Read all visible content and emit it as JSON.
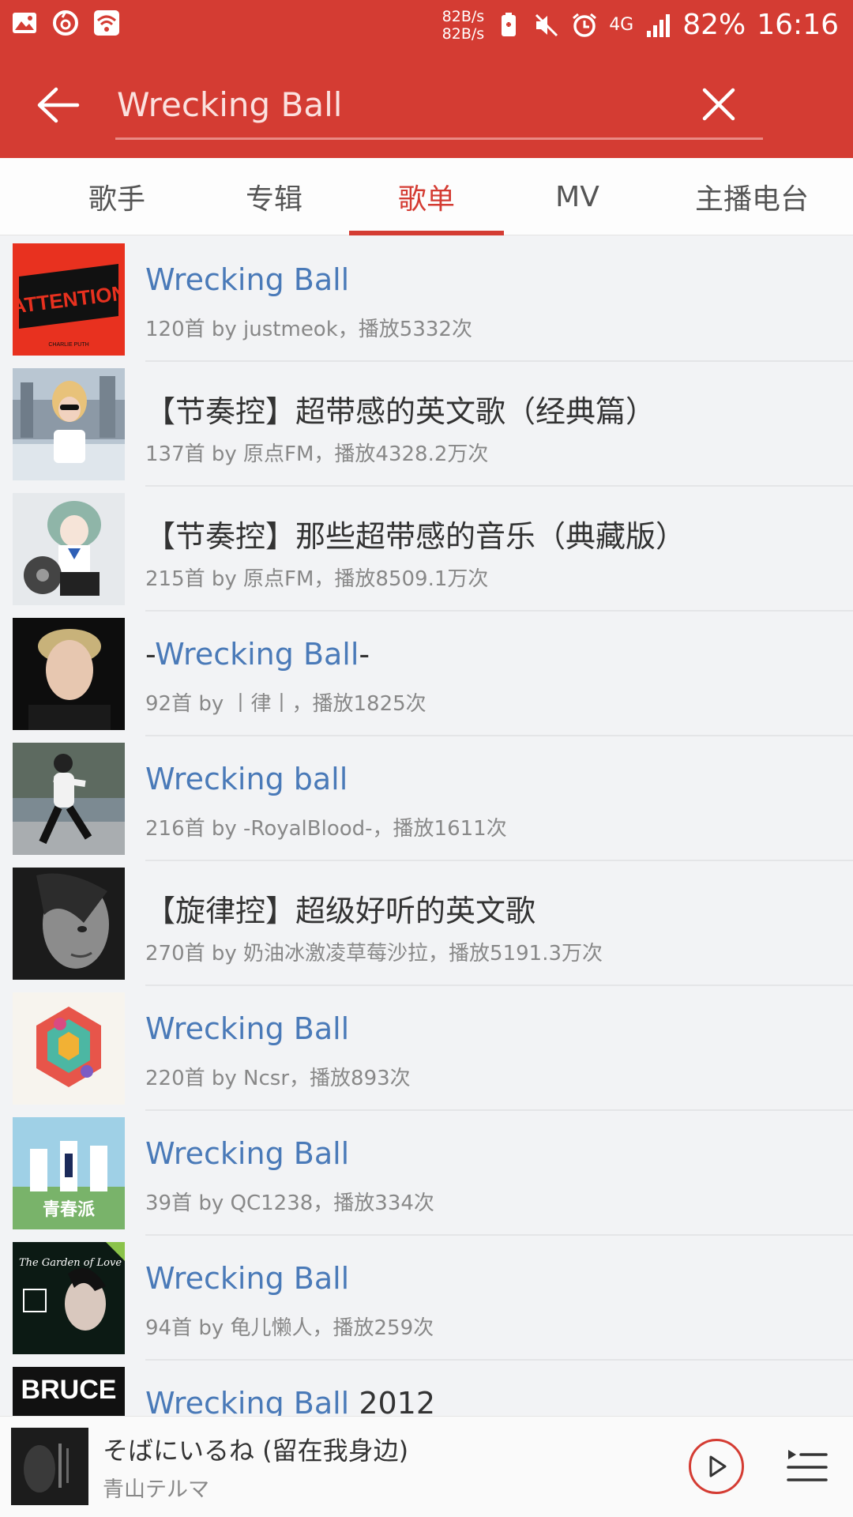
{
  "status_bar": {
    "net_speed_up": "82B/s",
    "net_speed_down": "82B/s",
    "network": "4G",
    "battery": "82%",
    "time": "16:16",
    "icons": [
      "image-icon",
      "netease-icon",
      "wifi-icon",
      "battery-saver-icon",
      "mute-icon",
      "alarm-icon",
      "signal-icon"
    ]
  },
  "search": {
    "query": "Wrecking Ball",
    "back_icon": "back-arrow-icon",
    "clear_icon": "close-icon"
  },
  "tabs": [
    {
      "label": "歌手",
      "active": false
    },
    {
      "label": "专辑",
      "active": false
    },
    {
      "label": "歌单",
      "active": true
    },
    {
      "label": "MV",
      "active": false
    },
    {
      "label": "主播电台",
      "active": false
    }
  ],
  "playlists": [
    {
      "title_pre": "",
      "title_hl": "Wrecking Ball",
      "title_post": "",
      "meta": "120首  by justmeok，播放5332次"
    },
    {
      "title_pre": "【节奏控】超带感的英文歌（经典篇）",
      "title_hl": "",
      "title_post": "",
      "meta": "137首  by 原点FM，播放4328.2万次"
    },
    {
      "title_pre": "【节奏控】那些超带感的音乐（典藏版）",
      "title_hl": "",
      "title_post": "",
      "meta": "215首  by 原点FM，播放8509.1万次"
    },
    {
      "title_pre": "-",
      "title_hl": "Wrecking Ball",
      "title_post": "-",
      "meta": "92首  by 丨律丨，播放1825次"
    },
    {
      "title_pre": "",
      "title_hl": "Wrecking ball",
      "title_post": "",
      "meta": "216首  by -RoyalBlood-，播放1611次"
    },
    {
      "title_pre": "【旋律控】超级好听的英文歌",
      "title_hl": "",
      "title_post": "",
      "meta": "270首  by 奶油冰激凌草莓沙拉，播放5191.3万次"
    },
    {
      "title_pre": "",
      "title_hl": "Wrecking Ball",
      "title_post": "",
      "meta": "220首  by Ncsr，播放893次"
    },
    {
      "title_pre": "",
      "title_hl": "Wrecking Ball",
      "title_post": "",
      "meta": "39首  by QC1238，播放334次"
    },
    {
      "title_pre": "",
      "title_hl": "Wrecking Ball",
      "title_post": "",
      "meta": "94首  by 龟儿懒人，播放259次"
    },
    {
      "title_pre": "",
      "title_hl": "Wrecking Ball",
      "title_post": " 2012",
      "meta": ""
    }
  ],
  "cover_text": {
    "attention": "ATTENTION",
    "charlie": "CHARLIE PUTH",
    "qingchun": "青春派",
    "garden": "The Garden of Love",
    "bruce": "BRUCE"
  },
  "player": {
    "title": "そばにいるね (留在我身边)",
    "artist": "青山テルマ",
    "play_icon": "play-icon",
    "queue_icon": "playlist-queue-icon"
  },
  "colors": {
    "brand": "#d43c33",
    "highlight": "#4a7ab8",
    "meta": "#888888"
  }
}
